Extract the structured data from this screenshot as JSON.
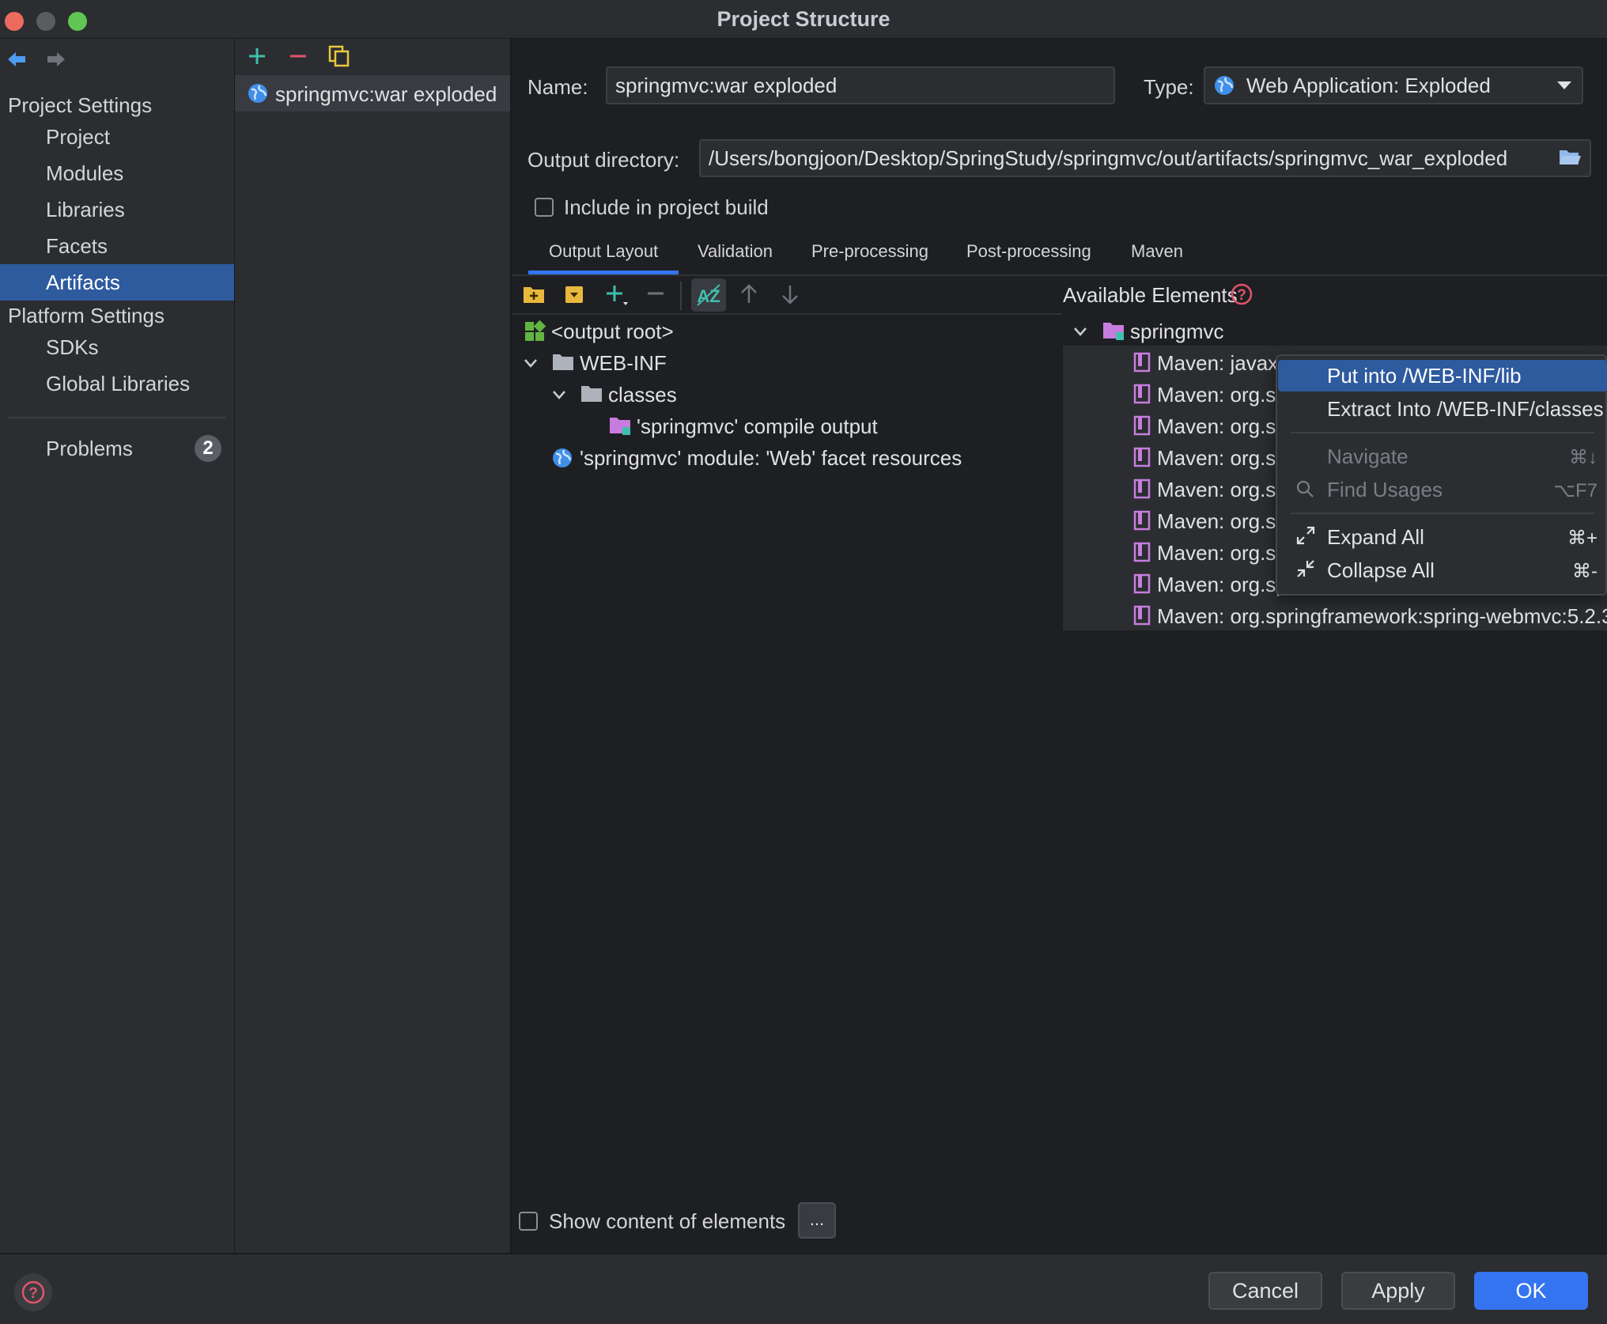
{
  "window": {
    "title": "Project Structure"
  },
  "nav": {
    "project_settings": "Project Settings",
    "items": [
      {
        "label": "Project"
      },
      {
        "label": "Modules"
      },
      {
        "label": "Libraries"
      },
      {
        "label": "Facets"
      },
      {
        "label": "Artifacts",
        "selected": true
      }
    ],
    "platform_settings": "Platform Settings",
    "platform_items": [
      {
        "label": "SDKs"
      },
      {
        "label": "Global Libraries"
      }
    ],
    "problems": {
      "label": "Problems",
      "count": "2"
    }
  },
  "artifacts": {
    "items": [
      {
        "label": "springmvc:war exploded"
      }
    ]
  },
  "form": {
    "name_label": "Name:",
    "name_value": "springmvc:war exploded",
    "type_label": "Type:",
    "type_value": "Web Application: Exploded",
    "output_label": "Output directory:",
    "output_value": "/Users/bongjoon/Desktop/SpringStudy/springmvc/out/artifacts/springmvc_war_exploded",
    "include_label": "Include in project build"
  },
  "tabs": [
    "Output Layout",
    "Validation",
    "Pre-processing",
    "Post-processing",
    "Maven"
  ],
  "output_tree": {
    "root": "<output root>",
    "webinf": "WEB-INF",
    "classes": "classes",
    "compile_output": "'springmvc' compile output",
    "facet_resources": "'springmvc' module: 'Web' facet resources"
  },
  "available": {
    "title": "Available Elements",
    "module": "springmvc",
    "items": [
      "Maven: javax",
      "Maven: org.sp",
      "Maven: org.sp",
      "Maven: org.sp",
      "Maven: org.sp",
      "Maven: org.sp",
      "Maven: org.sp",
      "Maven: org.sp",
      "Maven: org.springframework:spring-webmvc:5.2.3"
    ]
  },
  "context_menu": {
    "put_into": "Put into /WEB-INF/lib",
    "extract_into": "Extract Into /WEB-INF/classes",
    "navigate": "Navigate",
    "navigate_key": "⌘↓",
    "find_usages": "Find Usages",
    "find_usages_key": "⌥F7",
    "expand_all": "Expand All",
    "expand_all_key": "⌘+",
    "collapse_all": "Collapse All",
    "collapse_all_key": "⌘-"
  },
  "footer": {
    "show_content_label": "Show content of elements",
    "ellipsis": "...",
    "cancel": "Cancel",
    "apply": "Apply",
    "ok": "OK"
  },
  "colors": {
    "accent": "#3574f0",
    "selection": "#2e5a9e",
    "background": "#1e1f22",
    "panel": "#2b2d30"
  }
}
